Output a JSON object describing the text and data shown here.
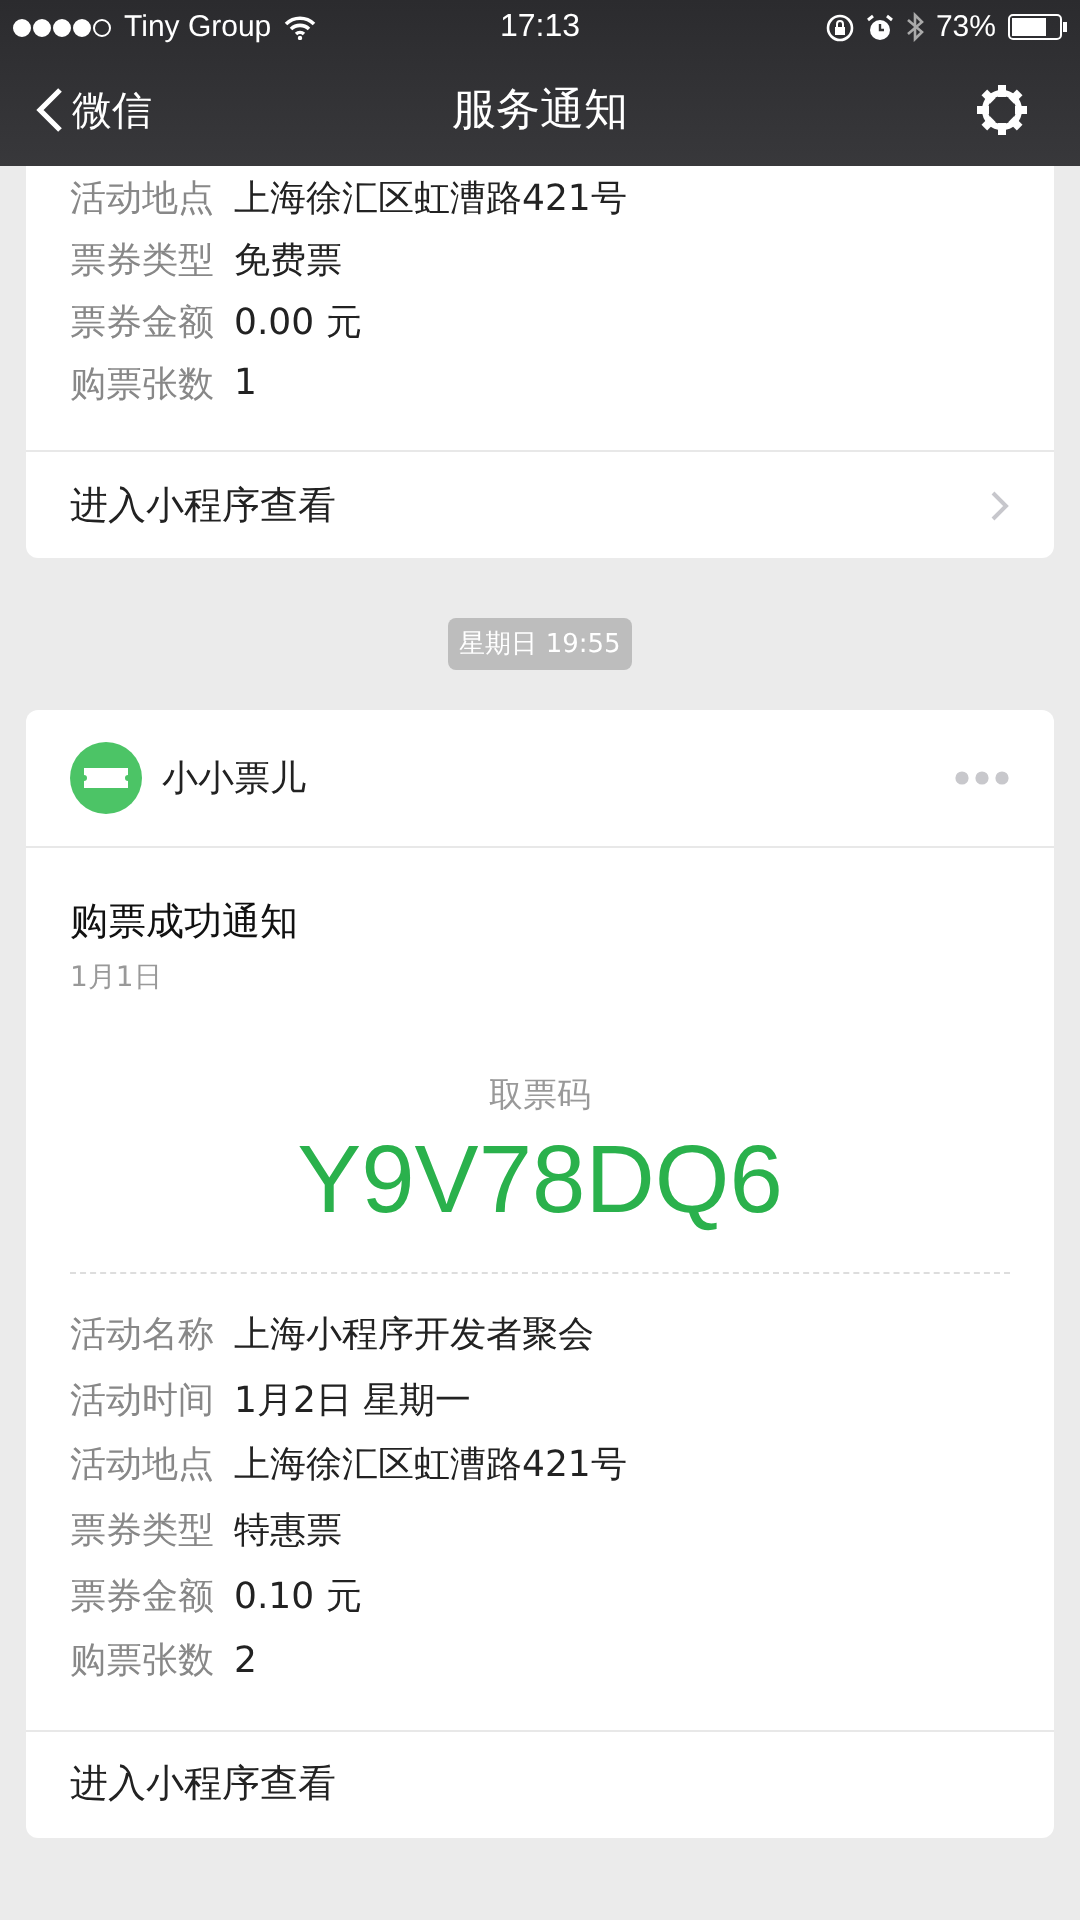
{
  "status_bar": {
    "carrier": "Tiny Group",
    "time": "17:13",
    "battery": "73%"
  },
  "nav": {
    "back": "微信",
    "title": "服务通知"
  },
  "cards": [
    {
      "fields": [
        {
          "label": "活动地点",
          "value": "上海徐汇区虹漕路421号"
        },
        {
          "label": "票券类型",
          "value": "免费票"
        },
        {
          "label": "票券金额",
          "value": "0.00 元"
        },
        {
          "label": "购票张数",
          "value": "1"
        }
      ],
      "link": {
        "label": "进入小程序查看",
        "chevron": true
      }
    },
    {
      "timestamp": "星期日 19:55",
      "header": {
        "app_name": "小小票儿"
      },
      "title": "购票成功通知",
      "date": "1月1日",
      "code_label": "取票码",
      "code": "Y9V78DQ6",
      "fields": [
        {
          "label": "活动名称",
          "value": "上海小程序开发者聚会"
        },
        {
          "label": "活动时间",
          "value": "1月2日 星期一"
        },
        {
          "label": "活动地点",
          "value": "上海徐汇区虹漕路421号"
        },
        {
          "label": "票券类型",
          "value": "特惠票"
        },
        {
          "label": "票券金额",
          "value": "0.10 元"
        },
        {
          "label": "购票张数",
          "value": "2"
        }
      ],
      "link": {
        "label": "进入小程序查看",
        "chevron": false
      }
    }
  ]
}
